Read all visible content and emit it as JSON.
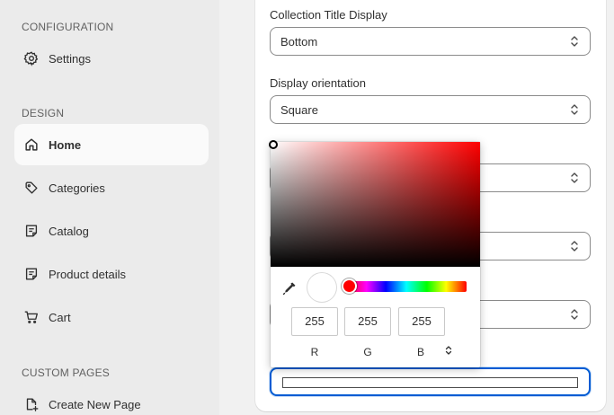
{
  "sidebar": {
    "configuration_title": "CONFIGURATION",
    "settings_label": "Settings",
    "design_title": "DESIGN",
    "items": [
      {
        "label": "Home",
        "icon": "home-icon",
        "active": true
      },
      {
        "label": "Categories",
        "icon": "tag-icon",
        "active": false
      },
      {
        "label": "Catalog",
        "icon": "catalog-icon",
        "active": false
      },
      {
        "label": "Product details",
        "icon": "catalog-icon",
        "active": false
      },
      {
        "label": "Cart",
        "icon": "cart-icon",
        "active": false
      }
    ],
    "custom_pages_title": "CUSTOM PAGES",
    "create_page_label": "Create New Page"
  },
  "form": {
    "collection_title_display": {
      "label": "Collection Title Display",
      "value": "Bottom"
    },
    "display_orientation": {
      "label": "Display orientation",
      "value": "Square"
    }
  },
  "color_picker": {
    "r": "255",
    "g": "255",
    "b": "255",
    "r_label": "R",
    "g_label": "G",
    "b_label": "B",
    "current_color": "#ffffff",
    "hue_color": "#ff0000"
  },
  "colors": {
    "focus": "#005bd3",
    "sidebar_bg": "#ebebeb"
  }
}
